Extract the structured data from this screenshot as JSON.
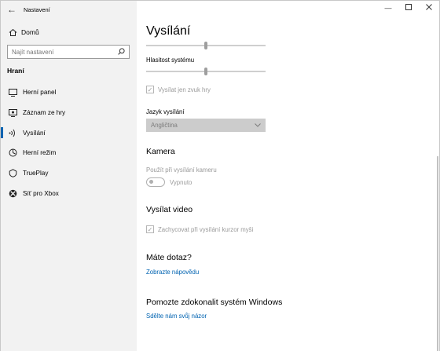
{
  "window": {
    "title": "Nastavení"
  },
  "sidebar": {
    "home_label": "Domů",
    "search_placeholder": "Najít nastavení",
    "section_title": "Hraní",
    "items": [
      {
        "label": "Herní panel",
        "icon": "game-bar-icon"
      },
      {
        "label": "Záznam ze hry",
        "icon": "game-dvr-icon"
      },
      {
        "label": "Vysílání",
        "icon": "broadcast-icon",
        "active": true
      },
      {
        "label": "Herní režim",
        "icon": "game-mode-icon"
      },
      {
        "label": "TruePlay",
        "icon": "trueplay-icon"
      },
      {
        "label": "Síť pro Xbox",
        "icon": "xbox-icon"
      }
    ]
  },
  "main": {
    "title": "Vysílání",
    "system_volume_label": "Hlasitost systému",
    "game_audio_only_label": "Vysílat jen zvuk hry",
    "language_label": "Jazyk vysílání",
    "language_value": "Angličtina",
    "camera": {
      "heading": "Kamera",
      "use_camera_label": "Použít při vysílání kameru",
      "toggle_state": "Vypnuto"
    },
    "video": {
      "heading": "Vysílat video",
      "capture_cursor_label": "Zachycovat při vysílání kurzor myši"
    },
    "help": {
      "heading": "Máte dotaz?",
      "link": "Zobrazte nápovědu"
    },
    "feedback": {
      "heading": "Pomozte zdokonalit systém Windows",
      "link": "Sdělte nám svůj názor"
    }
  },
  "colors": {
    "accent": "#0063b1",
    "sidebar_bg": "#f2f2f2",
    "disabled_text": "#9a9a9a"
  }
}
